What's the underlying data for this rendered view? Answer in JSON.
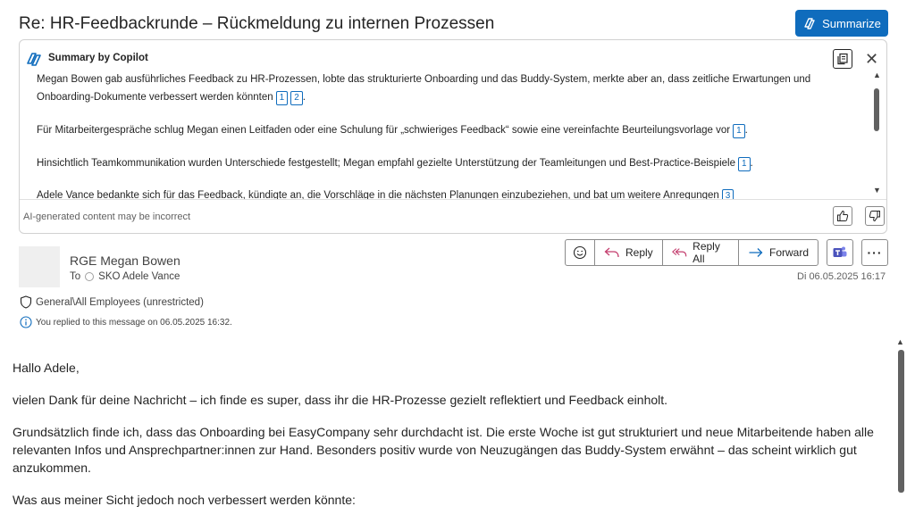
{
  "email": {
    "subject": "Re: HR-Feedbackrunde – Rückmeldung zu internen Prozessen",
    "summarize_label": "Summarize"
  },
  "copilot": {
    "title": "Summary by Copilot",
    "paragraphs": [
      {
        "text": "Megan Bowen gab ausführliches Feedback zu HR-Prozessen, lobte das strukturierte Onboarding und das Buddy-System, merkte aber an, dass zeitliche Erwartungen und Onboarding-Dokumente verbessert werden könnten",
        "citations": [
          "1",
          "2"
        ],
        "end": "."
      },
      {
        "text": "Für Mitarbeitergespräche schlug Megan einen Leitfaden oder eine Schulung für „schwieriges Feedback“ sowie eine vereinfachte Beurteilungsvorlage vor",
        "citations": [
          "1"
        ],
        "end": "."
      },
      {
        "text": "Hinsichtlich Teamkommunikation wurden Unterschiede festgestellt; Megan empfahl gezielte Unterstützung der Teamleitungen und Best-Practice-Beispiele",
        "citations": [
          "1"
        ],
        "end": "."
      },
      {
        "text": "Adele Vance bedankte sich für das Feedback, kündigte an, die Vorschläge in die nächsten Planungen einzubeziehen, und bat um weitere Anregungen",
        "citations": [
          "3"
        ],
        "end": ""
      }
    ],
    "disclaimer": "AI-generated content may be incorrect"
  },
  "header": {
    "sender": "RGE Megan Bowen",
    "to_label": "To",
    "recipient": "SKO Adele Vance",
    "date": "Di 06.05.2025 16:17",
    "sensitivity": "General\\All Employees (unrestricted)",
    "replied_note": "You replied to this message on 06.05.2025 16:32."
  },
  "actions": {
    "reply": "Reply",
    "reply_all": "Reply All",
    "forward": "Forward"
  },
  "body": {
    "greeting": "Hallo Adele,",
    "p1": "vielen Dank für deine Nachricht – ich finde es super, dass ihr die HR-Prozesse gezielt reflektiert und Feedback einholt.",
    "p2": "Grundsätzlich finde ich, dass das Onboarding bei EasyCompany sehr durchdacht ist. Die erste Woche ist gut strukturiert und neue Mitarbeitende haben alle relevanten Infos und Ansprechpartner:innen zur Hand. Besonders positiv wurde von Neuzugängen das Buddy-System erwähnt – das scheint wirklich gut anzukommen.",
    "p3": "Was aus meiner Sicht jedoch noch verbessert werden könnte:"
  },
  "colors": {
    "accent": "#0f6cbd",
    "reply_icon": "#c43e6e",
    "teams": "#4b53bc"
  },
  "icons": [
    "copilot-icon",
    "copy-icon",
    "close-icon",
    "thumbs-up-icon",
    "thumbs-down-icon",
    "emoji-icon",
    "reply-icon",
    "reply-all-icon",
    "forward-icon",
    "teams-icon",
    "more-icon",
    "shield-icon",
    "info-icon"
  ]
}
